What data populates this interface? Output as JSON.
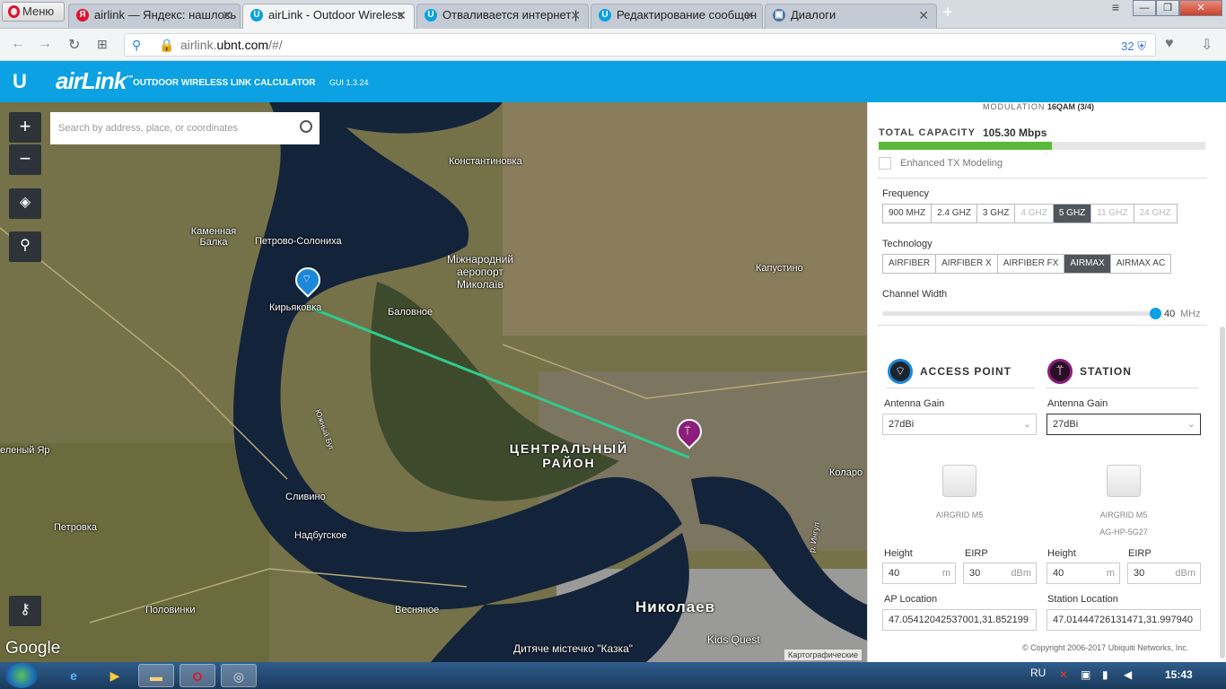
{
  "browser": {
    "menu_label": "Меню",
    "tabs": [
      {
        "title": "airlink — Яндекс: нашлось",
        "icon": "Я",
        "color": "#e0112b"
      },
      {
        "title": "airLink - Outdoor Wireless",
        "icon": "U",
        "color": "#0ba1e2"
      },
      {
        "title": "Отваливается интернет |",
        "icon": "U",
        "color": "#0ba1e2"
      },
      {
        "title": "Редактирование сообщен",
        "icon": "U",
        "color": "#0ba1e2"
      },
      {
        "title": "Диалоги",
        "icon": "▣",
        "color": "#4a76a8"
      }
    ],
    "url_host": "airlink.",
    "url_domain": "ubnt.com",
    "url_path": "/#/",
    "badge_count": "32"
  },
  "app": {
    "logo_mark": "U",
    "logo_name": "airLink",
    "logo_tm": "™",
    "subtitle": "OUTDOOR WIRELESS LINK CALCULATOR",
    "version": "GUI 1.3.24"
  },
  "map": {
    "search_placeholder": "Search by address, place, or coordinates",
    "zoom_in": "+",
    "zoom_out": "−",
    "labels": {
      "l1": "Константиновка",
      "l2": "Каменная Балка",
      "l3": "Петрово-Солониха",
      "l4": "Міжнародний аеропорт Миколаїв",
      "l5": "Капустино",
      "l6": "Кирьяковка",
      "l7": "Баловное",
      "l8": "еленый Яр",
      "l9": "ЦЕНТРАЛЬНЫЙ РАЙОН",
      "l10": "Сливино",
      "l11": "Петровка",
      "l12": "Надбугское",
      "l13": "Половинки",
      "l14": "Весняное",
      "l15": "Николаев",
      "l16": "Kids Quest",
      "l17": "Дитяче містечко \"Казка\"",
      "l18": "Коларо",
      "l19": "Южный Буг",
      "l20": "р. Ингул"
    },
    "google": "Google",
    "map_copyright": "Картографические"
  },
  "panel": {
    "modulation_label": "MODULATION",
    "modulation_value": "16QAM (3/4)",
    "total_capacity_label": "TOTAL CAPACITY",
    "total_capacity_value": "105.30 Mbps",
    "capacity_fill_percent": 53,
    "enhanced_tx": "Enhanced TX Modeling",
    "frequency_label": "Frequency",
    "frequencies": [
      "900 MHZ",
      "2.4 GHZ",
      "3 GHZ",
      "4 GHZ",
      "5 GHZ",
      "11 GHZ",
      "24 GHZ"
    ],
    "frequency_selected": "5 GHZ",
    "frequency_disabled": [
      "4 GHZ",
      "11 GHZ",
      "24 GHZ"
    ],
    "technology_label": "Technology",
    "technologies": [
      "AIRFIBER",
      "AIRFIBER X",
      "AIRFIBER FX",
      "AIRMAX",
      "AIRMAX AC"
    ],
    "technology_selected": "AIRMAX",
    "channel_width_label": "Channel Width",
    "channel_width_value": "40",
    "channel_width_unit": "MHz",
    "channel_width_fraction": 1.0,
    "ap": {
      "title": "ACCESS POINT",
      "antenna_gain_label": "Antenna Gain",
      "antenna_gain": "27dBi",
      "device": "AIRGRID M5",
      "device_sub": "",
      "height_label": "Height",
      "height": "40",
      "height_unit": "m",
      "eirp_label": "EIRP",
      "eirp": "30",
      "eirp_unit": "dBm",
      "location_label": "AP Location",
      "location": "47.05412042537001,31.852199"
    },
    "station": {
      "title": "STATION",
      "antenna_gain_label": "Antenna Gain",
      "antenna_gain": "27dBi",
      "device": "AIRGRID M5",
      "device_sub": "AG-HP-5G27",
      "height_label": "Height",
      "height": "40",
      "height_unit": "m",
      "eirp_label": "EIRP",
      "eirp": "30",
      "eirp_unit": "dBm",
      "location_label": "Station Location",
      "location": "47.01444726131471,31.997940"
    },
    "copyright": "© Copyright 2006-2017 Ubiquiti Networks, Inc."
  },
  "taskbar": {
    "lang": "RU",
    "time": "15:43"
  },
  "colors": {
    "brand": "#0ba1e2",
    "link_line": "#2ecc8f",
    "capacity": "#5bb83a",
    "ap_pin": "#1e88d8",
    "station_pin": "#8a1e7a"
  }
}
